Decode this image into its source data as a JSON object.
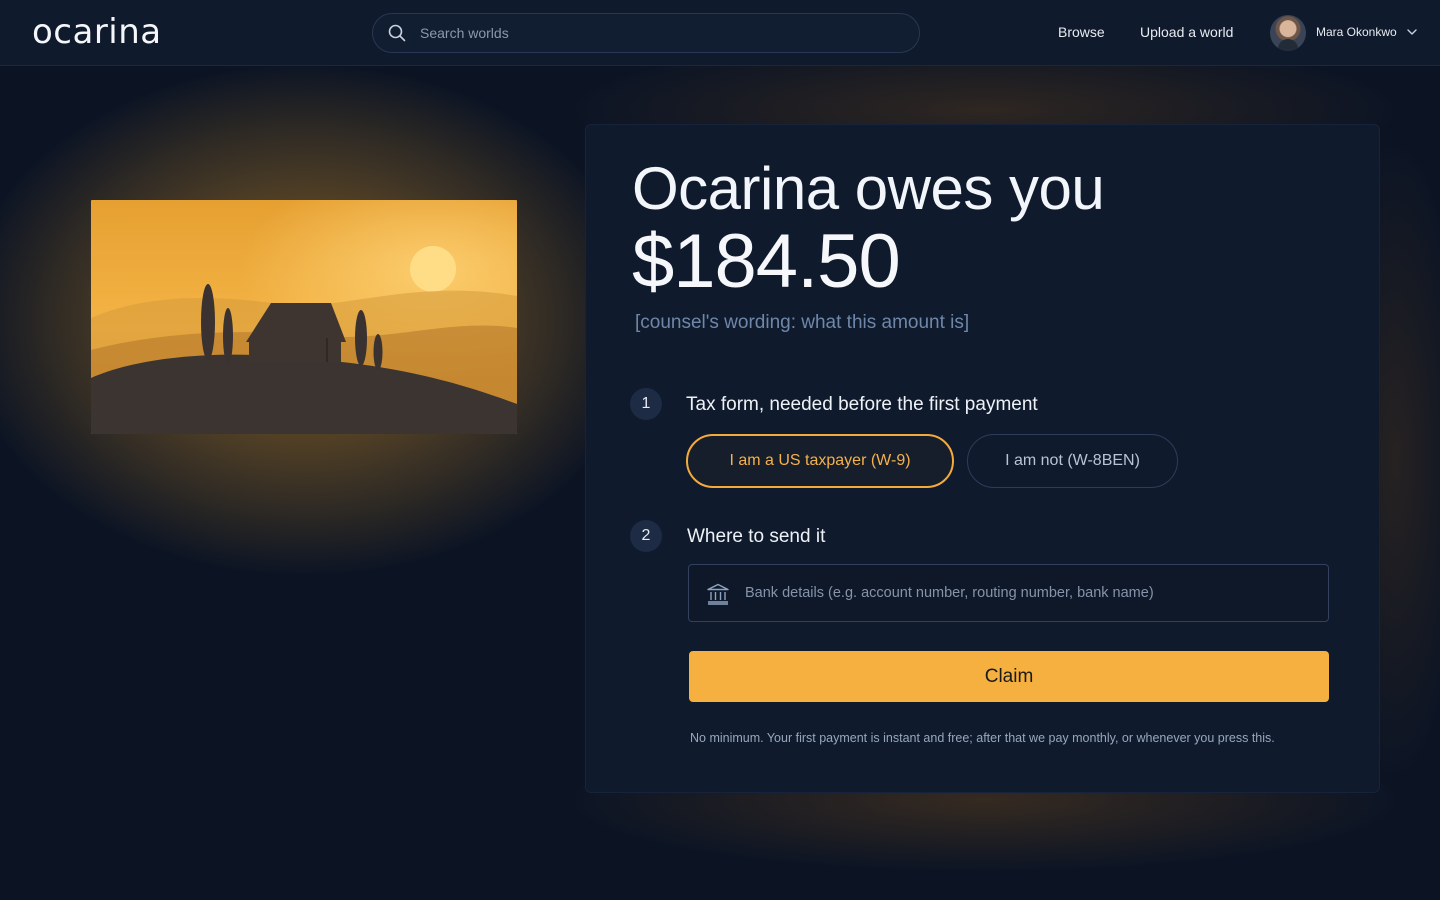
{
  "header": {
    "logo": "ocarina",
    "search_placeholder": "Search worlds",
    "nav": {
      "browse": "Browse",
      "upload": "Upload a world"
    },
    "user": {
      "name": "Mara Okonkwo"
    }
  },
  "claim": {
    "headline": "Ocarina owes you",
    "amount": "$184.50",
    "amount_note": "[counsel's wording: what this amount is]",
    "steps": [
      {
        "number": "1",
        "title": "Tax form, needed before the first payment",
        "options": [
          {
            "label": "I am a US taxpayer (W-9)",
            "selected": true
          },
          {
            "label": "I am not (W-8BEN)",
            "selected": false
          }
        ]
      },
      {
        "number": "2",
        "title": "Where to send it",
        "bank_placeholder": "Bank details (e.g. account number, routing number, bank name)"
      }
    ],
    "claim_button": "Claim",
    "fine_print": "No minimum. Your first payment is instant and free; after that we pay monthly, or whenever you press this."
  },
  "colors": {
    "accent": "#f6b03f",
    "background": "#0c1424",
    "card": "#0f1a2d"
  }
}
